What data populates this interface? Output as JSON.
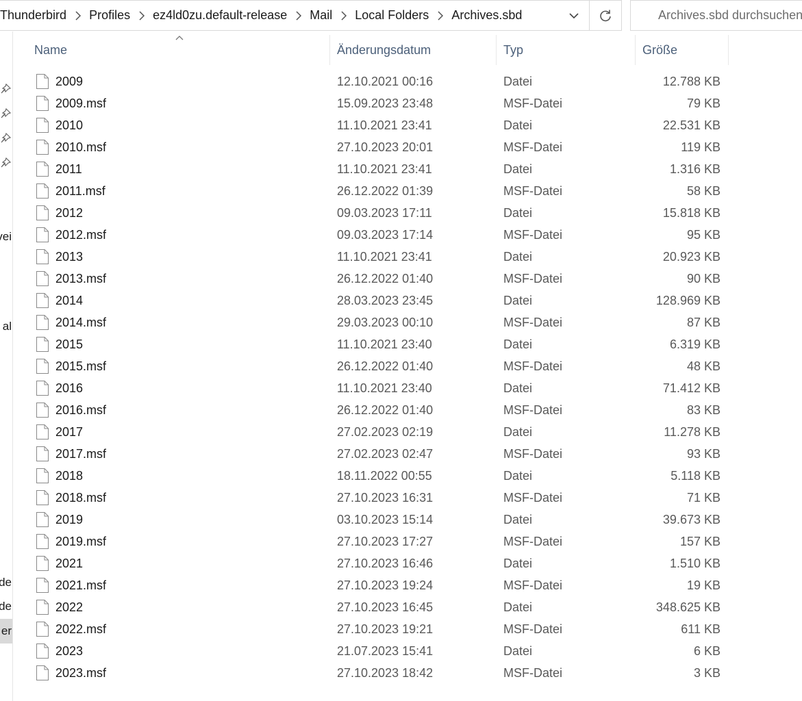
{
  "address_bar": {
    "crumbs": [
      "Thunderbird",
      "Profiles",
      "ez4ld0zu.default-release",
      "Mail",
      "Local Folders",
      "Archives.sbd"
    ]
  },
  "search": {
    "placeholder": "Archives.sbd durchsuchen"
  },
  "nav_pane": {
    "truncated_labels": [
      "vei",
      "al",
      ".de",
      ".de",
      "er"
    ]
  },
  "columns": {
    "name": "Name",
    "date": "Änderungsdatum",
    "type": "Typ",
    "size": "Größe"
  },
  "files": [
    {
      "name": "2009",
      "date": "12.10.2021 00:16",
      "type": "Datei",
      "size": "12.788 KB"
    },
    {
      "name": "2009.msf",
      "date": "15.09.2023 23:48",
      "type": "MSF-Datei",
      "size": "79 KB"
    },
    {
      "name": "2010",
      "date": "11.10.2021 23:41",
      "type": "Datei",
      "size": "22.531 KB"
    },
    {
      "name": "2010.msf",
      "date": "27.10.2023 20:01",
      "type": "MSF-Datei",
      "size": "119 KB"
    },
    {
      "name": "2011",
      "date": "11.10.2021 23:41",
      "type": "Datei",
      "size": "1.316 KB"
    },
    {
      "name": "2011.msf",
      "date": "26.12.2022 01:39",
      "type": "MSF-Datei",
      "size": "58 KB"
    },
    {
      "name": "2012",
      "date": "09.03.2023 17:11",
      "type": "Datei",
      "size": "15.818 KB"
    },
    {
      "name": "2012.msf",
      "date": "09.03.2023 17:14",
      "type": "MSF-Datei",
      "size": "95 KB"
    },
    {
      "name": "2013",
      "date": "11.10.2021 23:41",
      "type": "Datei",
      "size": "20.923 KB"
    },
    {
      "name": "2013.msf",
      "date": "26.12.2022 01:40",
      "type": "MSF-Datei",
      "size": "90 KB"
    },
    {
      "name": "2014",
      "date": "28.03.2023 23:45",
      "type": "Datei",
      "size": "128.969 KB"
    },
    {
      "name": "2014.msf",
      "date": "29.03.2023 00:10",
      "type": "MSF-Datei",
      "size": "87 KB"
    },
    {
      "name": "2015",
      "date": "11.10.2021 23:40",
      "type": "Datei",
      "size": "6.319 KB"
    },
    {
      "name": "2015.msf",
      "date": "26.12.2022 01:40",
      "type": "MSF-Datei",
      "size": "48 KB"
    },
    {
      "name": "2016",
      "date": "11.10.2021 23:40",
      "type": "Datei",
      "size": "71.412 KB"
    },
    {
      "name": "2016.msf",
      "date": "26.12.2022 01:40",
      "type": "MSF-Datei",
      "size": "83 KB"
    },
    {
      "name": "2017",
      "date": "27.02.2023 02:19",
      "type": "Datei",
      "size": "11.278 KB"
    },
    {
      "name": "2017.msf",
      "date": "27.02.2023 02:47",
      "type": "MSF-Datei",
      "size": "93 KB"
    },
    {
      "name": "2018",
      "date": "18.11.2022 00:55",
      "type": "Datei",
      "size": "5.118 KB"
    },
    {
      "name": "2018.msf",
      "date": "27.10.2023 16:31",
      "type": "MSF-Datei",
      "size": "71 KB"
    },
    {
      "name": "2019",
      "date": "03.10.2023 15:14",
      "type": "Datei",
      "size": "39.673 KB"
    },
    {
      "name": "2019.msf",
      "date": "27.10.2023 17:27",
      "type": "MSF-Datei",
      "size": "157 KB"
    },
    {
      "name": "2021",
      "date": "27.10.2023 16:46",
      "type": "Datei",
      "size": "1.510 KB"
    },
    {
      "name": "2021.msf",
      "date": "27.10.2023 19:24",
      "type": "MSF-Datei",
      "size": "19 KB"
    },
    {
      "name": "2022",
      "date": "27.10.2023 16:45",
      "type": "Datei",
      "size": "348.625 KB"
    },
    {
      "name": "2022.msf",
      "date": "27.10.2023 19:21",
      "type": "MSF-Datei",
      "size": "611 KB"
    },
    {
      "name": "2023",
      "date": "21.07.2023 15:41",
      "type": "Datei",
      "size": "6 KB"
    },
    {
      "name": "2023.msf",
      "date": "27.10.2023 18:42",
      "type": "MSF-Datei",
      "size": "3 KB"
    }
  ]
}
